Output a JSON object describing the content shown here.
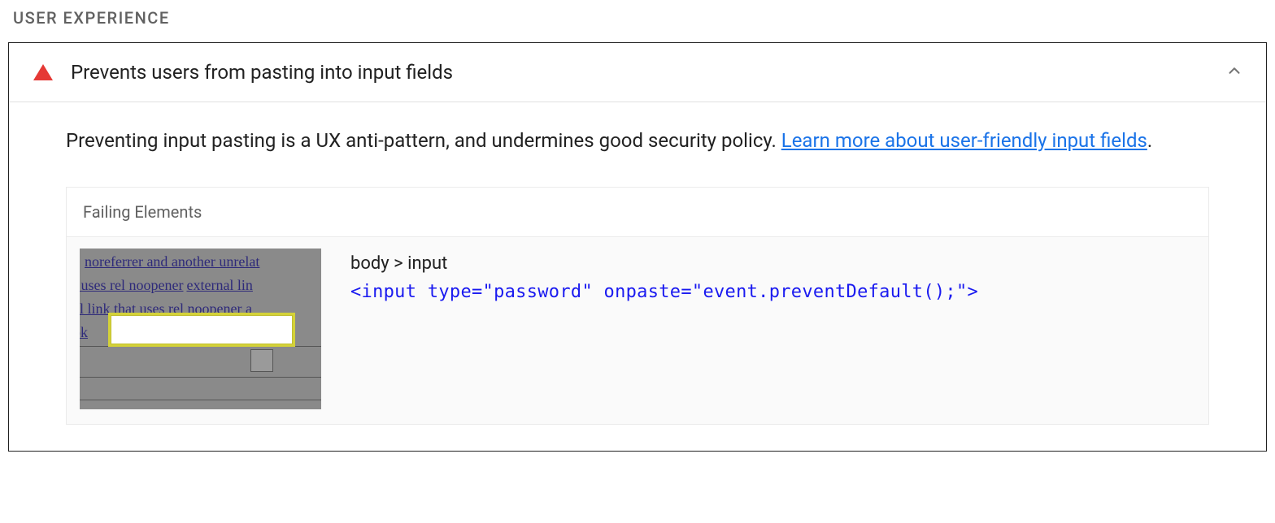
{
  "section": {
    "heading": "USER EXPERIENCE"
  },
  "audit": {
    "title": "Prevents users from pasting into input fields",
    "description_text": "Preventing input pasting is a UX anti-pattern, and undermines good security policy. ",
    "learn_more_text": "Learn more about user-friendly input fields",
    "period": "."
  },
  "failing": {
    "header": "Failing Elements",
    "items": [
      {
        "selector": "body > input",
        "code": "<input type=\"password\" onpaste=\"event.preventDefault();\">",
        "thumb": {
          "l1": "noreferrer and another unrelat",
          "l2a": "t uses rel noopener",
          "l2b": "external lin",
          "l3": "al link that uses rel noopener a",
          "l4": "ok"
        }
      }
    ]
  }
}
